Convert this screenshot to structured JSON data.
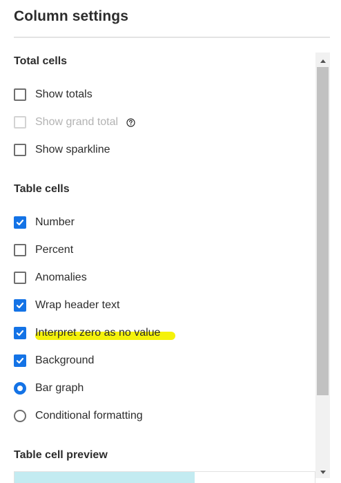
{
  "panel": {
    "title": "Column settings"
  },
  "total_cells": {
    "heading": "Total cells",
    "options": [
      {
        "label": "Show totals",
        "checked": false,
        "disabled": false
      },
      {
        "label": "Show grand total",
        "checked": false,
        "disabled": true,
        "help_icon": "help-circle-icon"
      },
      {
        "label": "Show sparkline",
        "checked": false,
        "disabled": false
      }
    ]
  },
  "table_cells": {
    "heading": "Table cells",
    "options": [
      {
        "label": "Number",
        "checked": true
      },
      {
        "label": "Percent",
        "checked": false
      },
      {
        "label": "Anomalies",
        "checked": false
      },
      {
        "label": "Wrap header text",
        "checked": true
      },
      {
        "label": "Interpret zero as no value",
        "checked": true,
        "highlighted": true
      },
      {
        "label": "Background",
        "checked": true
      }
    ],
    "display_mode": {
      "options": [
        {
          "label": "Bar graph",
          "selected": true
        },
        {
          "label": "Conditional formatting",
          "selected": false
        }
      ]
    }
  },
  "preview": {
    "heading": "Table cell preview",
    "bar_fill_fraction": 0.6,
    "bar_color": "#c3ebf1"
  },
  "colors": {
    "accent": "#1473e6",
    "highlight": "#f5f20a",
    "disabled_text": "#b3b3b3",
    "text": "#2c2c2c"
  },
  "scrollbar": {
    "up_icon": "triangle-up-icon",
    "down_icon": "triangle-down-icon"
  }
}
